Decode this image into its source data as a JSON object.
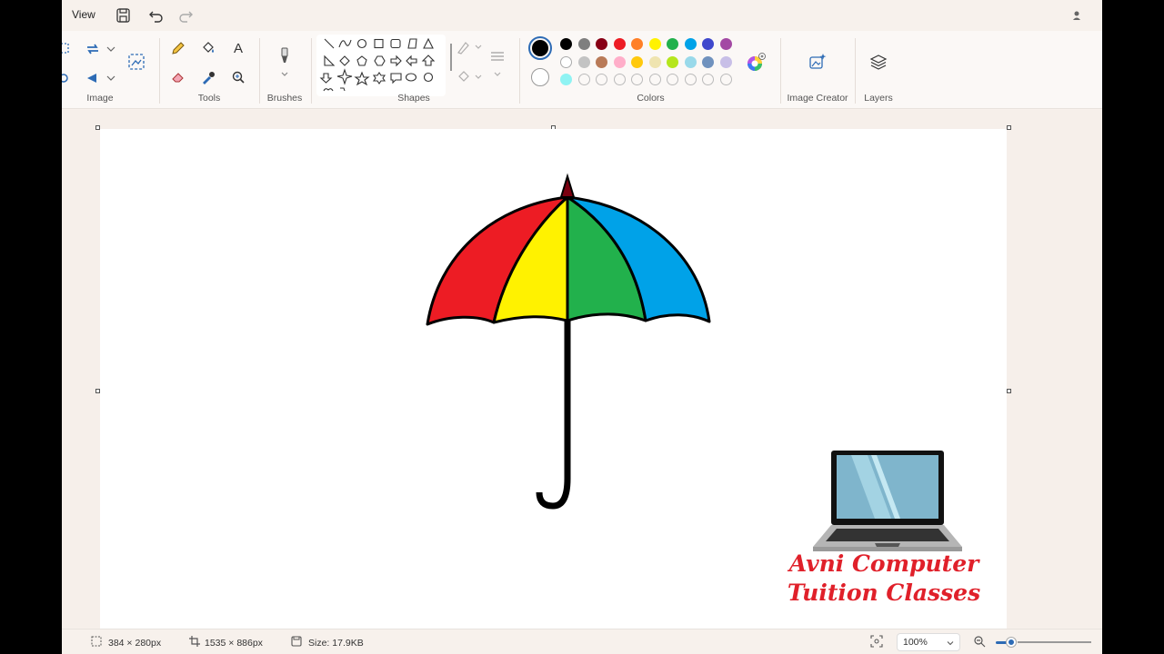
{
  "titlebar": {
    "view_label": "View"
  },
  "ribbon": {
    "groups": {
      "image": "Image",
      "tools": "Tools",
      "brushes": "Brushes",
      "shapes": "Shapes",
      "colors": "Colors",
      "image_creator": "Image Creator",
      "layers": "Layers"
    },
    "text_tool_glyph": "A"
  },
  "colors": {
    "primary": "#000000",
    "secondary": "#ffffff",
    "row1": [
      "#000000",
      "#7f7f7f",
      "#880015",
      "#ed1c24",
      "#ff7f27",
      "#fff200",
      "#22b14c",
      "#00a2e8",
      "#3f48cc",
      "#a349a4"
    ],
    "row2": [
      "#ffffff",
      "#c3c3c3",
      "#b97a57",
      "#ffaec9",
      "#ffc90e",
      "#efe4b0",
      "#b5e61d",
      "#99d9ea",
      "#7092be",
      "#c8bfe7"
    ],
    "row3": [
      "#8ff3f3",
      "",
      "",
      "",
      "",
      "",
      "",
      "",
      "",
      ""
    ]
  },
  "canvas_art": {
    "umbrella_colors": [
      "#ed1c24",
      "#fff200",
      "#22b14c",
      "#00a2e8"
    ],
    "tip_color": "#7a0010",
    "logo_line1": "Avni Computer",
    "logo_line2": "Tuition Classes"
  },
  "status": {
    "selection_size": "384 × 280px",
    "canvas_size": "1535 × 886px",
    "file_size": "Size: 17.9KB",
    "zoom": "100%"
  }
}
